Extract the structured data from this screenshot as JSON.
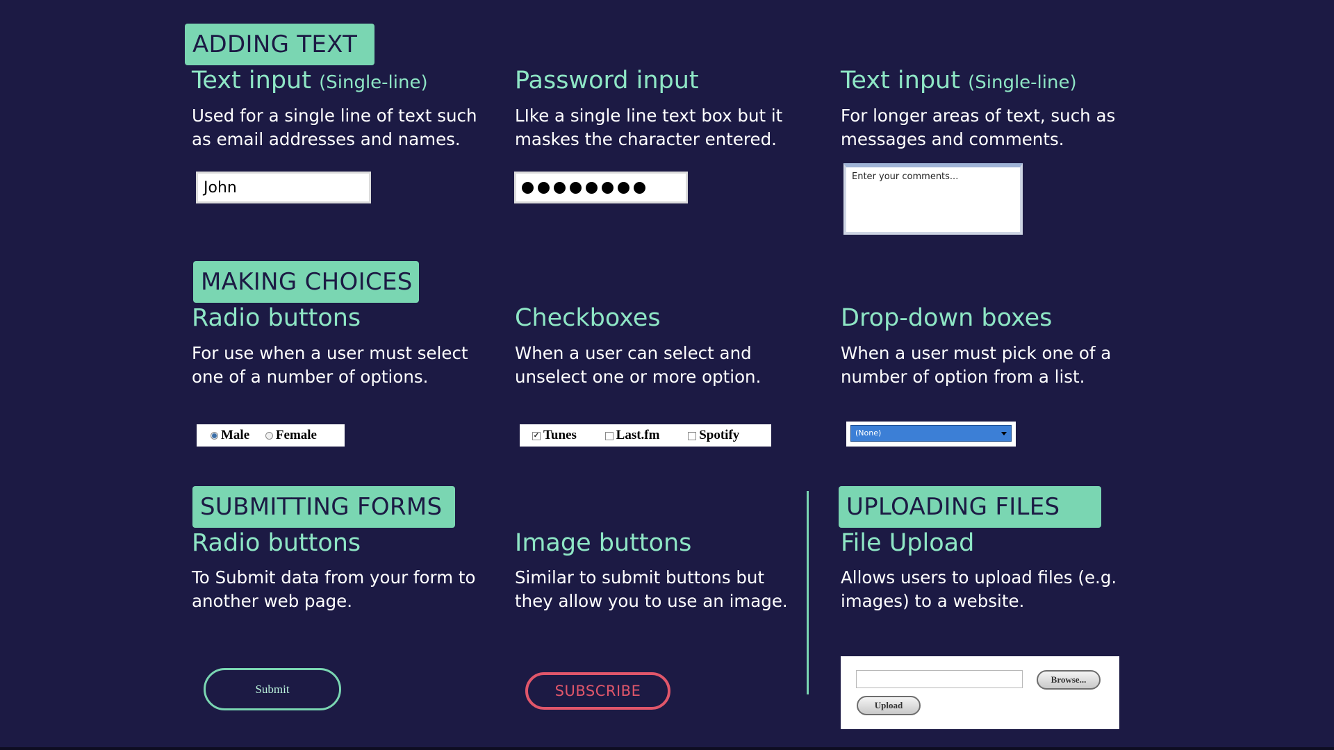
{
  "adding_text": {
    "header": "ADDING TEXT",
    "text_input": {
      "title": "Text input",
      "title_sub": "(Single-line)",
      "desc": "Used for a single line of text such as email addresses and names.",
      "value": "John"
    },
    "password_input": {
      "title": "Password input",
      "desc": "LIke a single line text box but it maskes the character entered.",
      "masked_count": 8
    },
    "textarea": {
      "title": "Text input",
      "title_sub": "(Single-line)",
      "desc": "For longer areas of text, such as messages and comments.",
      "placeholder": "Enter your comments..."
    }
  },
  "making_choices": {
    "header": "MAKING CHOICES",
    "radio": {
      "title": "Radio buttons",
      "desc": "For use when a user must select one of a number of options.",
      "options": [
        {
          "label": "Male",
          "selected": true
        },
        {
          "label": "Female",
          "selected": false
        }
      ]
    },
    "checkboxes": {
      "title": "Checkboxes",
      "desc": "When a user can select and unselect one or more option.",
      "options": [
        {
          "label": "Tunes",
          "checked": true
        },
        {
          "label": "Last.fm",
          "checked": false
        },
        {
          "label": "Spotify",
          "checked": false
        }
      ]
    },
    "dropdown": {
      "title": "Drop-down boxes",
      "desc": "When a user must pick one of a number of option from a list.",
      "selected": "(None)"
    }
  },
  "submitting_forms": {
    "header": "SUBMITTING FORMS",
    "submit": {
      "title": "Radio buttons",
      "desc": "To Submit data from your form to another web page.",
      "button_label": "Submit"
    },
    "image_buttons": {
      "title": "Image buttons",
      "desc": "Similar to submit buttons but they allow you to use an image.",
      "button_label": "SUBSCRIBE"
    }
  },
  "uploading_files": {
    "header": "UPLOADING FILES",
    "file_upload": {
      "title": "File Upload",
      "desc": "Allows users to upload files (e.g. images) to a website.",
      "browse_label": "Browse...",
      "upload_label": "Upload"
    }
  },
  "colors": {
    "background": "#1c1a44",
    "accent": "#7ad6b2",
    "title_text": "#8ee6c5",
    "subscribe_red": "#e0566a"
  }
}
